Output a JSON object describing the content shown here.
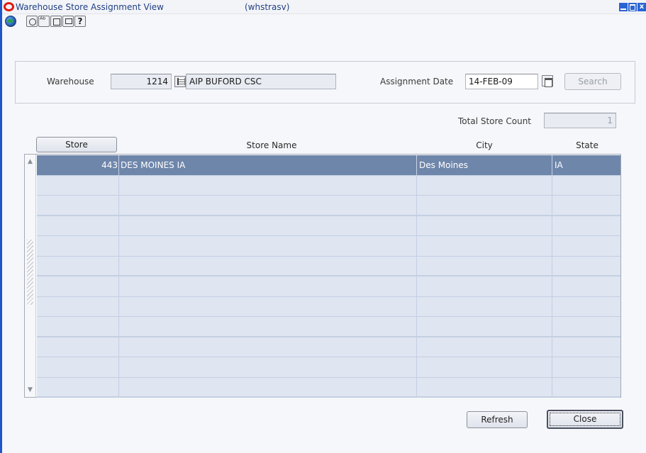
{
  "window": {
    "title": "Warehouse Store Assignment View",
    "form_code": "(whstrasv)"
  },
  "toolbar": {
    "icons": [
      "globe-icon",
      "save-icon",
      "spell-check-icon",
      "calendar-icon",
      "edit-icon",
      "help-icon"
    ],
    "help_glyph": "?"
  },
  "header": {
    "warehouse_label": "Warehouse",
    "warehouse_id": "1214",
    "warehouse_name": "AIP BUFORD CSC",
    "assignment_date_label": "Assignment Date",
    "assignment_date": "14-FEB-09",
    "search_label": "Search"
  },
  "summary": {
    "total_store_count_label": "Total Store Count",
    "total_store_count": "1"
  },
  "table": {
    "columns": [
      "Store",
      "Store Name",
      "City",
      "State"
    ],
    "rows": [
      {
        "store": "443",
        "name": "DES MOINES IA",
        "city": "Des Moines",
        "state": "IA"
      },
      {
        "store": "",
        "name": "",
        "city": "",
        "state": ""
      },
      {
        "store": "",
        "name": "",
        "city": "",
        "state": ""
      },
      {
        "store": "",
        "name": "",
        "city": "",
        "state": ""
      },
      {
        "store": "",
        "name": "",
        "city": "",
        "state": ""
      },
      {
        "store": "",
        "name": "",
        "city": "",
        "state": ""
      },
      {
        "store": "",
        "name": "",
        "city": "",
        "state": ""
      },
      {
        "store": "",
        "name": "",
        "city": "",
        "state": ""
      },
      {
        "store": "",
        "name": "",
        "city": "",
        "state": ""
      },
      {
        "store": "",
        "name": "",
        "city": "",
        "state": ""
      },
      {
        "store": "",
        "name": "",
        "city": "",
        "state": ""
      },
      {
        "store": "",
        "name": "",
        "city": "",
        "state": ""
      }
    ]
  },
  "buttons": {
    "refresh_label": "Refresh",
    "close_label": "Close"
  }
}
